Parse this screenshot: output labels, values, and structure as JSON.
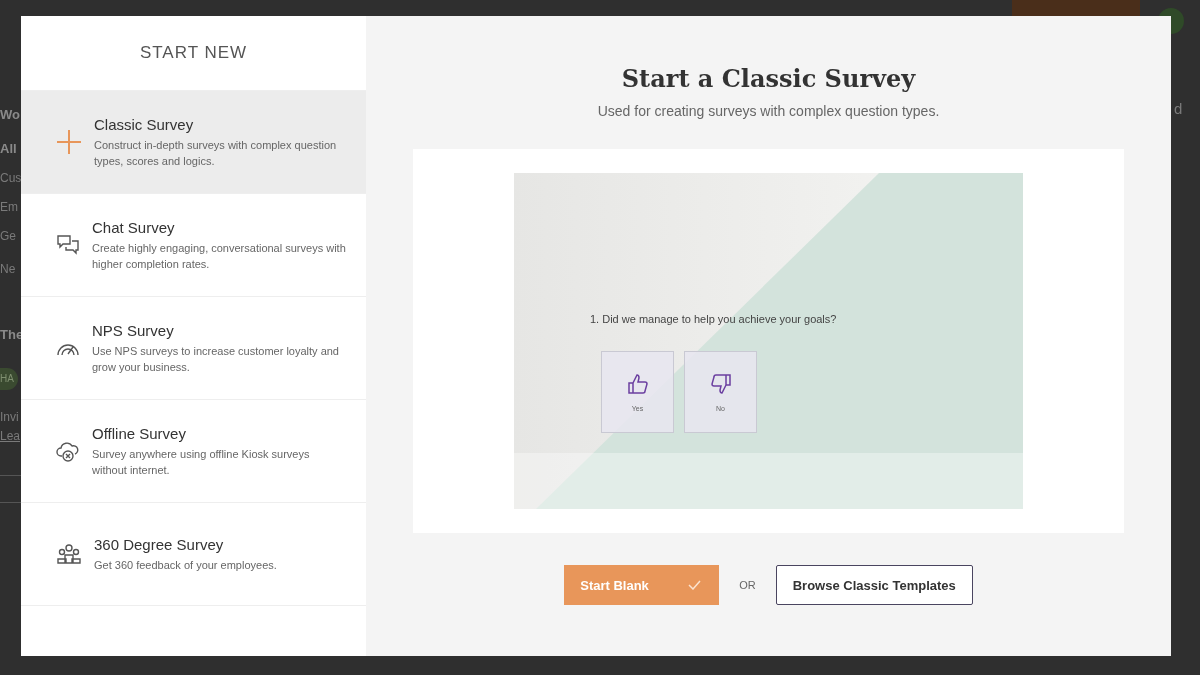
{
  "backdrop": {
    "left_texts": [
      {
        "kind": "heading",
        "text": "Wo"
      },
      {
        "kind": "heading",
        "text": "All"
      },
      {
        "kind": "text",
        "text": "Cus"
      },
      {
        "kind": "text",
        "text": "Em"
      },
      {
        "kind": "text",
        "text": "Ge"
      },
      {
        "kind": "text",
        "text": "Ne"
      },
      {
        "kind": "heading",
        "text": "The"
      },
      {
        "kind": "avatar",
        "text": "HA"
      },
      {
        "kind": "text",
        "text": "Invi"
      },
      {
        "kind": "link",
        "text": "Lea"
      }
    ],
    "right_text": "d"
  },
  "modal": {
    "sidebar": {
      "title": "START NEW",
      "items": [
        {
          "kind": "classic",
          "title": "Classic Survey",
          "description": "Construct in-depth surveys with complex question types, scores and logics.",
          "selected": true
        },
        {
          "kind": "chat",
          "title": "Chat Survey",
          "description": "Create highly engaging, conversational surveys with higher completion rates.",
          "selected": false
        },
        {
          "kind": "nps",
          "title": "NPS Survey",
          "description": "Use NPS surveys to increase customer loyalty and grow your business.",
          "selected": false
        },
        {
          "kind": "offline",
          "title": "Offline Survey",
          "description": "Survey anywhere using offline Kiosk surveys without internet.",
          "selected": false
        },
        {
          "kind": "degree360",
          "title": "360 Degree Survey",
          "description": "Get 360 feedback of your employees.",
          "selected": false
        }
      ]
    },
    "main": {
      "title": "Start a Classic Survey",
      "subtitle": "Used for creating surveys with complex question types.",
      "preview": {
        "question": "1. Did we manage to help you achieve your goals?",
        "options": [
          {
            "kind": "up",
            "label": "Yes"
          },
          {
            "kind": "down",
            "label": "No"
          }
        ]
      },
      "primary_button": "Start Blank",
      "separator": "OR",
      "secondary_button": "Browse Classic Templates"
    }
  }
}
